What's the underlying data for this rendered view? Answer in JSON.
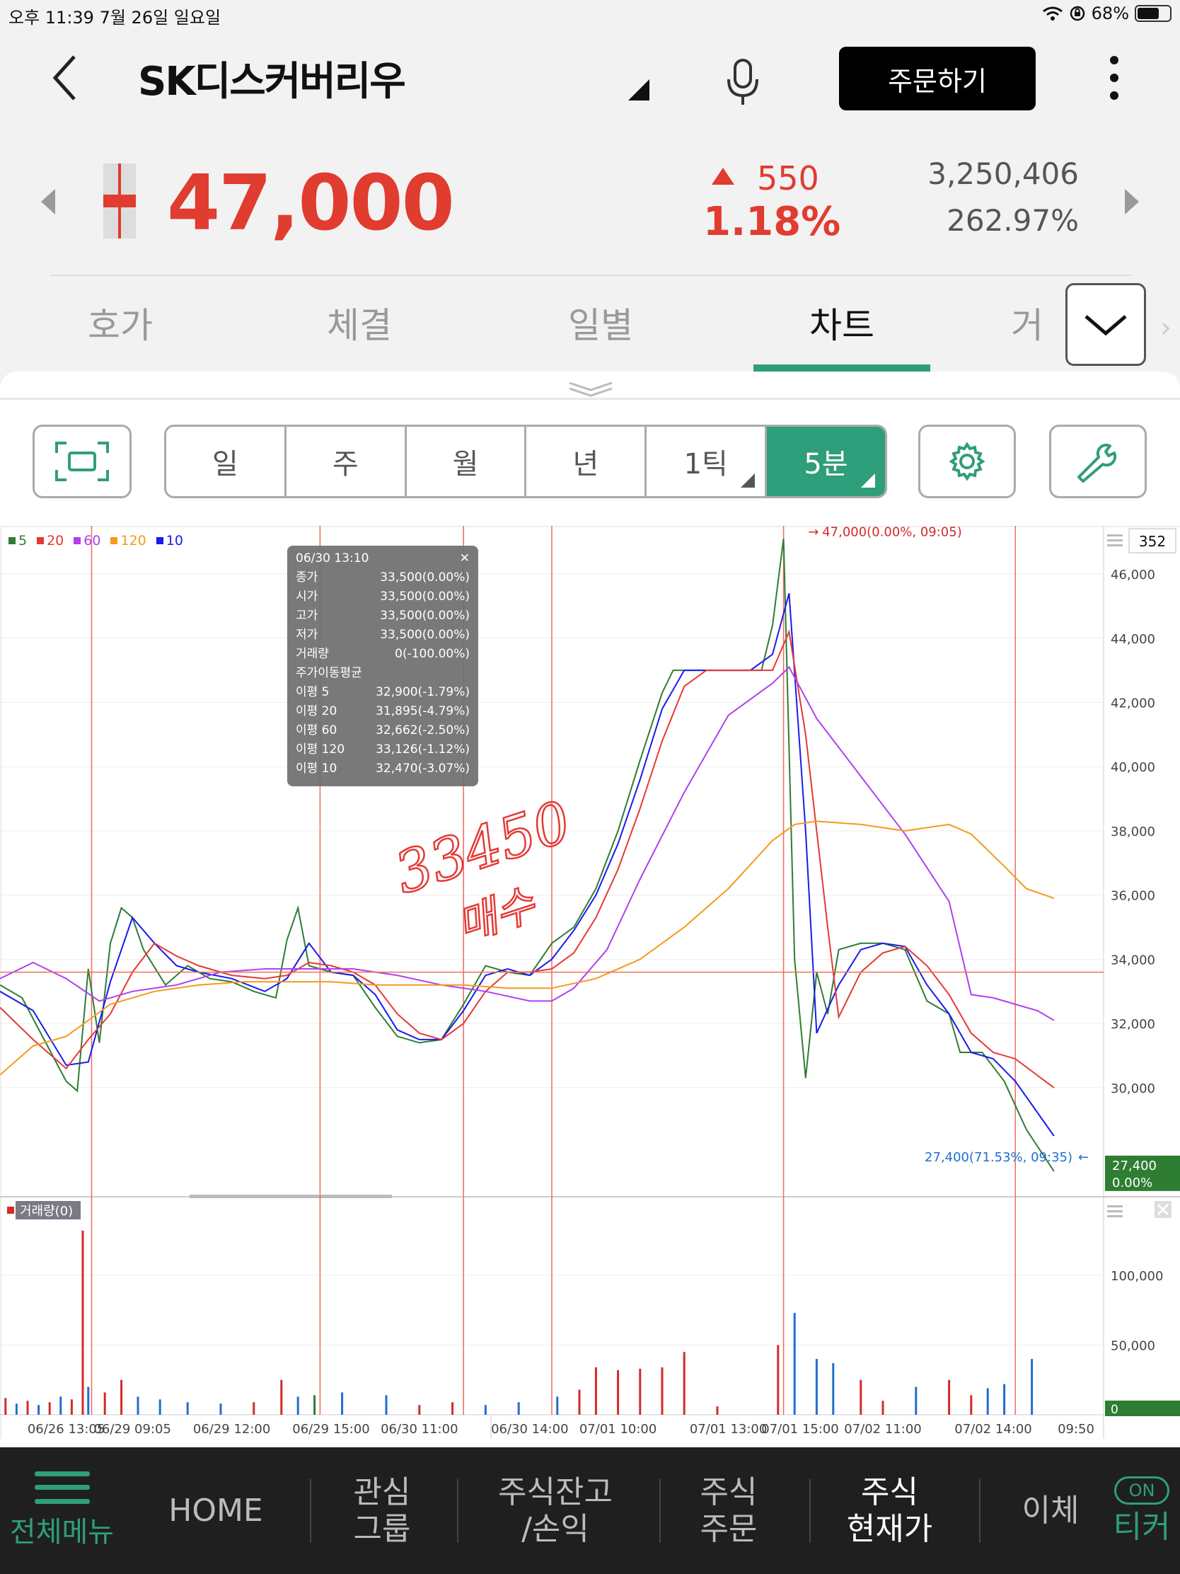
{
  "status": {
    "time_date": "오후 11:39   7월 26일 일요일",
    "battery": "68%",
    "battery_level": 0.68
  },
  "header": {
    "stock_name": "SK디스커버리우",
    "order_label": "주문하기"
  },
  "price": {
    "current": "47,000",
    "change": "550",
    "change_pct": "1.18%",
    "volume": "3,250,406",
    "volume_pct": "262.97%"
  },
  "tabs": [
    "호가",
    "체결",
    "일별",
    "차트",
    "거"
  ],
  "active_tab": "차트",
  "periods": [
    "일",
    "주",
    "월",
    "년",
    "1틱",
    "5분"
  ],
  "active_period": "5분",
  "legend": [
    {
      "label": "5",
      "color": "#2e7d32"
    },
    {
      "label": "20",
      "color": "#e53935"
    },
    {
      "label": "60",
      "color": "#b040f0"
    },
    {
      "label": "120",
      "color": "#f39a1f"
    },
    {
      "label": "10",
      "color": "#1a1aee"
    }
  ],
  "tooltip": {
    "time": "06/30 13:10",
    "rows": [
      [
        "종가",
        "33,500(0.00%)"
      ],
      [
        "시가",
        "33,500(0.00%)"
      ],
      [
        "고가",
        "33,500(0.00%)"
      ],
      [
        "저가",
        "33,500(0.00%)"
      ],
      [
        "거래량",
        "0(-100.00%)"
      ],
      [
        "주가이동평균",
        ""
      ],
      [
        "이평 5",
        "32,900(-1.79%)"
      ],
      [
        "이평 20",
        "31,895(-4.79%)"
      ],
      [
        "이평 60",
        "32,662(-2.50%)"
      ],
      [
        "이평 120",
        "33,126(-1.12%)"
      ],
      [
        "이평 10",
        "32,470(-3.07%)"
      ]
    ]
  },
  "chart_data": {
    "type": "line",
    "y_ticks": [
      "46,000",
      "44,000",
      "42,000",
      "40,000",
      "38,000",
      "36,000",
      "34,000",
      "32,000",
      "30,000"
    ],
    "y_range": [
      27000,
      47500
    ],
    "x_tick_labels": [
      "06/26 13:05",
      "06/29 09:05",
      "06/29 12:00",
      "06/29 15:00",
      "06/30 11:00",
      "06/30 14:00",
      "07/01 10:00",
      "07/01 13:00",
      "07/01 15:00",
      "07/02 11:00",
      "07/02 14:00",
      "09:50"
    ],
    "x_domain": [
      0,
      100
    ],
    "x_tick_positions": [
      6,
      12,
      21,
      30,
      38,
      48,
      56,
      66,
      72.5,
      80,
      90,
      97.5
    ],
    "day_dividers": [
      8.3,
      29,
      42,
      50,
      71,
      92
    ],
    "crosshair_value": 33600,
    "visible_count": "352",
    "high_label": "47,000(0.00%, 09:05)",
    "low_label": "27,400(71.53%, 09:35)",
    "last_price": "27,400",
    "last_pct": "0.00%",
    "annotation_text": "33450 매수",
    "series": [
      {
        "name": "5",
        "color": "#2e7d32",
        "points": [
          [
            0,
            33200
          ],
          [
            2,
            32800
          ],
          [
            4,
            31500
          ],
          [
            6,
            30200
          ],
          [
            7,
            29900
          ],
          [
            8,
            33700
          ],
          [
            9,
            31400
          ],
          [
            10,
            34500
          ],
          [
            11,
            35600
          ],
          [
            12,
            35300
          ],
          [
            13,
            34300
          ],
          [
            15,
            33200
          ],
          [
            17,
            33800
          ],
          [
            19,
            33400
          ],
          [
            21,
            33300
          ],
          [
            23,
            33000
          ],
          [
            25,
            32800
          ],
          [
            26,
            34600
          ],
          [
            27,
            35600
          ],
          [
            28,
            33800
          ],
          [
            30,
            33600
          ],
          [
            32,
            33500
          ],
          [
            34,
            32500
          ],
          [
            36,
            31600
          ],
          [
            38,
            31400
          ],
          [
            40,
            31500
          ],
          [
            42,
            32600
          ],
          [
            44,
            33800
          ],
          [
            46,
            33600
          ],
          [
            48,
            33500
          ],
          [
            50,
            34500
          ],
          [
            52,
            35000
          ],
          [
            54,
            36200
          ],
          [
            56,
            38000
          ],
          [
            58,
            40200
          ],
          [
            60,
            42300
          ],
          [
            61,
            43000
          ],
          [
            63,
            43000
          ],
          [
            65,
            43000
          ],
          [
            67,
            43000
          ],
          [
            69,
            43000
          ],
          [
            70,
            44400
          ],
          [
            71,
            47100
          ],
          [
            72,
            34000
          ],
          [
            73,
            30300
          ],
          [
            74,
            33600
          ],
          [
            75,
            32300
          ],
          [
            76,
            34300
          ],
          [
            78,
            34500
          ],
          [
            80,
            34500
          ],
          [
            82,
            34300
          ],
          [
            84,
            32700
          ],
          [
            86,
            32300
          ],
          [
            87,
            31100
          ],
          [
            89,
            31100
          ],
          [
            91,
            30200
          ],
          [
            93,
            28700
          ],
          [
            95.5,
            27400
          ]
        ]
      },
      {
        "name": "10",
        "color": "#1a1aee",
        "points": [
          [
            0,
            33000
          ],
          [
            3,
            32400
          ],
          [
            6,
            30700
          ],
          [
            8,
            30800
          ],
          [
            10,
            33300
          ],
          [
            12,
            35300
          ],
          [
            14,
            34500
          ],
          [
            16,
            33800
          ],
          [
            18,
            33600
          ],
          [
            21,
            33400
          ],
          [
            24,
            33000
          ],
          [
            26,
            33400
          ],
          [
            28,
            34500
          ],
          [
            30,
            33600
          ],
          [
            32,
            33500
          ],
          [
            34,
            32900
          ],
          [
            36,
            31800
          ],
          [
            38,
            31500
          ],
          [
            40,
            31500
          ],
          [
            42,
            32400
          ],
          [
            44,
            33500
          ],
          [
            46,
            33700
          ],
          [
            48,
            33500
          ],
          [
            50,
            34000
          ],
          [
            52,
            34900
          ],
          [
            54,
            36000
          ],
          [
            56,
            37600
          ],
          [
            58,
            39600
          ],
          [
            60,
            41800
          ],
          [
            62,
            43000
          ],
          [
            65,
            43000
          ],
          [
            68,
            43000
          ],
          [
            70,
            43500
          ],
          [
            71.5,
            45400
          ],
          [
            73,
            38000
          ],
          [
            74,
            31700
          ],
          [
            76,
            33200
          ],
          [
            78,
            34300
          ],
          [
            80,
            34500
          ],
          [
            82,
            34400
          ],
          [
            84,
            33200
          ],
          [
            86,
            32300
          ],
          [
            88,
            31100
          ],
          [
            90,
            30900
          ],
          [
            92,
            30200
          ],
          [
            95.5,
            28500
          ]
        ]
      },
      {
        "name": "20",
        "color": "#e53935",
        "points": [
          [
            0,
            32500
          ],
          [
            3,
            31500
          ],
          [
            6,
            30600
          ],
          [
            8,
            31500
          ],
          [
            10,
            32300
          ],
          [
            12,
            33600
          ],
          [
            14,
            34500
          ],
          [
            16,
            34100
          ],
          [
            18,
            33800
          ],
          [
            21,
            33500
          ],
          [
            24,
            33400
          ],
          [
            26,
            33500
          ],
          [
            28,
            33900
          ],
          [
            30,
            33800
          ],
          [
            32,
            33600
          ],
          [
            34,
            33200
          ],
          [
            36,
            32300
          ],
          [
            38,
            31700
          ],
          [
            40,
            31500
          ],
          [
            42,
            32000
          ],
          [
            44,
            33000
          ],
          [
            46,
            33600
          ],
          [
            48,
            33600
          ],
          [
            50,
            33700
          ],
          [
            52,
            34200
          ],
          [
            54,
            35300
          ],
          [
            56,
            36800
          ],
          [
            58,
            38700
          ],
          [
            60,
            40800
          ],
          [
            62,
            42500
          ],
          [
            64,
            43000
          ],
          [
            68,
            43000
          ],
          [
            70,
            43000
          ],
          [
            71.5,
            44200
          ],
          [
            73,
            41000
          ],
          [
            75,
            35000
          ],
          [
            76,
            32200
          ],
          [
            78,
            33600
          ],
          [
            80,
            34200
          ],
          [
            82,
            34400
          ],
          [
            84,
            33800
          ],
          [
            86,
            32900
          ],
          [
            88,
            31700
          ],
          [
            90,
            31100
          ],
          [
            92,
            30900
          ],
          [
            95.5,
            30000
          ]
        ]
      },
      {
        "name": "60",
        "color": "#b040f0",
        "points": [
          [
            0,
            33400
          ],
          [
            3,
            33900
          ],
          [
            6,
            33400
          ],
          [
            9,
            32700
          ],
          [
            12,
            33000
          ],
          [
            16,
            33200
          ],
          [
            20,
            33600
          ],
          [
            24,
            33700
          ],
          [
            28,
            33700
          ],
          [
            32,
            33700
          ],
          [
            36,
            33500
          ],
          [
            40,
            33200
          ],
          [
            44,
            33000
          ],
          [
            48,
            32700
          ],
          [
            50,
            32700
          ],
          [
            52,
            33100
          ],
          [
            55,
            34300
          ],
          [
            58,
            36500
          ],
          [
            62,
            39200
          ],
          [
            66,
            41600
          ],
          [
            70,
            42600
          ],
          [
            71.5,
            43100
          ],
          [
            74,
            41500
          ],
          [
            78,
            39700
          ],
          [
            82,
            37900
          ],
          [
            86,
            35800
          ],
          [
            88,
            32900
          ],
          [
            90,
            32800
          ],
          [
            92,
            32600
          ],
          [
            94,
            32400
          ],
          [
            95.5,
            32100
          ]
        ]
      },
      {
        "name": "120",
        "color": "#f39a1f",
        "points": [
          [
            0,
            30400
          ],
          [
            3,
            31300
          ],
          [
            6,
            31600
          ],
          [
            10,
            32600
          ],
          [
            14,
            33000
          ],
          [
            18,
            33200
          ],
          [
            22,
            33300
          ],
          [
            26,
            33300
          ],
          [
            30,
            33300
          ],
          [
            34,
            33200
          ],
          [
            38,
            33200
          ],
          [
            42,
            33200
          ],
          [
            46,
            33100
          ],
          [
            50,
            33100
          ],
          [
            54,
            33400
          ],
          [
            58,
            34000
          ],
          [
            62,
            35000
          ],
          [
            66,
            36200
          ],
          [
            70,
            37700
          ],
          [
            72,
            38200
          ],
          [
            74,
            38300
          ],
          [
            78,
            38200
          ],
          [
            82,
            38000
          ],
          [
            86,
            38200
          ],
          [
            88,
            37900
          ],
          [
            91,
            36900
          ],
          [
            93,
            36200
          ],
          [
            95.5,
            35900
          ]
        ]
      }
    ],
    "volume_y_ticks": [
      "100,000",
      "50,000"
    ],
    "volume_range": [
      0,
      140000
    ],
    "volume_label": "거래량(0)",
    "volume_current": "0",
    "volume_bars": [
      {
        "x": 0.5,
        "v": 12000,
        "c": "#d42a2a"
      },
      {
        "x": 1.5,
        "v": 8000,
        "c": "#1f6fcf"
      },
      {
        "x": 2.5,
        "v": 10000,
        "c": "#d42a2a"
      },
      {
        "x": 3.5,
        "v": 7000,
        "c": "#1f6fcf"
      },
      {
        "x": 4.5,
        "v": 9000,
        "c": "#d42a2a"
      },
      {
        "x": 5.5,
        "v": 13000,
        "c": "#1f6fcf"
      },
      {
        "x": 6.5,
        "v": 11000,
        "c": "#d42a2a"
      },
      {
        "x": 7.5,
        "v": 132000,
        "c": "#d42a2a"
      },
      {
        "x": 8,
        "v": 20000,
        "c": "#1f6fcf"
      },
      {
        "x": 9.5,
        "v": 16000,
        "c": "#d42a2a"
      },
      {
        "x": 11,
        "v": 25000,
        "c": "#d42a2a"
      },
      {
        "x": 12.5,
        "v": 13000,
        "c": "#1f6fcf"
      },
      {
        "x": 14.5,
        "v": 11000,
        "c": "#1f6fcf"
      },
      {
        "x": 17,
        "v": 9000,
        "c": "#1f6fcf"
      },
      {
        "x": 20,
        "v": 8000,
        "c": "#1f6fcf"
      },
      {
        "x": 23,
        "v": 9000,
        "c": "#d42a2a"
      },
      {
        "x": 25.5,
        "v": 25000,
        "c": "#d42a2a"
      },
      {
        "x": 27,
        "v": 13000,
        "c": "#1f6fcf"
      },
      {
        "x": 28.5,
        "v": 14000,
        "c": "#2e7d32"
      },
      {
        "x": 31,
        "v": 16000,
        "c": "#1f6fcf"
      },
      {
        "x": 35,
        "v": 14000,
        "c": "#1f6fcf"
      },
      {
        "x": 38,
        "v": 7000,
        "c": "#d42a2a"
      },
      {
        "x": 41,
        "v": 9000,
        "c": "#d42a2a"
      },
      {
        "x": 44,
        "v": 7000,
        "c": "#1f6fcf"
      },
      {
        "x": 47,
        "v": 9000,
        "c": "#1f6fcf"
      },
      {
        "x": 50.5,
        "v": 13000,
        "c": "#1f6fcf"
      },
      {
        "x": 52.5,
        "v": 18000,
        "c": "#d42a2a"
      },
      {
        "x": 54,
        "v": 34000,
        "c": "#d42a2a"
      },
      {
        "x": 56,
        "v": 32000,
        "c": "#d42a2a"
      },
      {
        "x": 58,
        "v": 33000,
        "c": "#d42a2a"
      },
      {
        "x": 60,
        "v": 34000,
        "c": "#d42a2a"
      },
      {
        "x": 62,
        "v": 45000,
        "c": "#d42a2a"
      },
      {
        "x": 65,
        "v": 6000,
        "c": "#d42a2a"
      },
      {
        "x": 70.5,
        "v": 50000,
        "c": "#d42a2a"
      },
      {
        "x": 72,
        "v": 73000,
        "c": "#1f6fcf"
      },
      {
        "x": 74,
        "v": 40000,
        "c": "#1f6fcf"
      },
      {
        "x": 75.5,
        "v": 37000,
        "c": "#1f6fcf"
      },
      {
        "x": 78,
        "v": 25000,
        "c": "#d42a2a"
      },
      {
        "x": 80,
        "v": 10000,
        "c": "#d42a2a"
      },
      {
        "x": 83,
        "v": 20000,
        "c": "#1f6fcf"
      },
      {
        "x": 86,
        "v": 25000,
        "c": "#d42a2a"
      },
      {
        "x": 88,
        "v": 14000,
        "c": "#d42a2a"
      },
      {
        "x": 89.5,
        "v": 19000,
        "c": "#1f6fcf"
      },
      {
        "x": 91,
        "v": 22000,
        "c": "#1f6fcf"
      },
      {
        "x": 93.5,
        "v": 40000,
        "c": "#1f6fcf"
      }
    ]
  },
  "bottom_nav": [
    {
      "id": "menu",
      "label": "전체메뉴"
    },
    {
      "id": "home",
      "label": "HOME"
    },
    {
      "id": "watch",
      "line1": "관심",
      "line2": "그룹"
    },
    {
      "id": "balance",
      "line1": "주식잔고",
      "line2": "/손익"
    },
    {
      "id": "order",
      "line1": "주식",
      "line2": "주문"
    },
    {
      "id": "quote",
      "line1": "주식",
      "line2": "현재가"
    },
    {
      "id": "transfer",
      "label": "이체"
    },
    {
      "id": "ticker",
      "on": "ON",
      "label": "티커"
    }
  ]
}
